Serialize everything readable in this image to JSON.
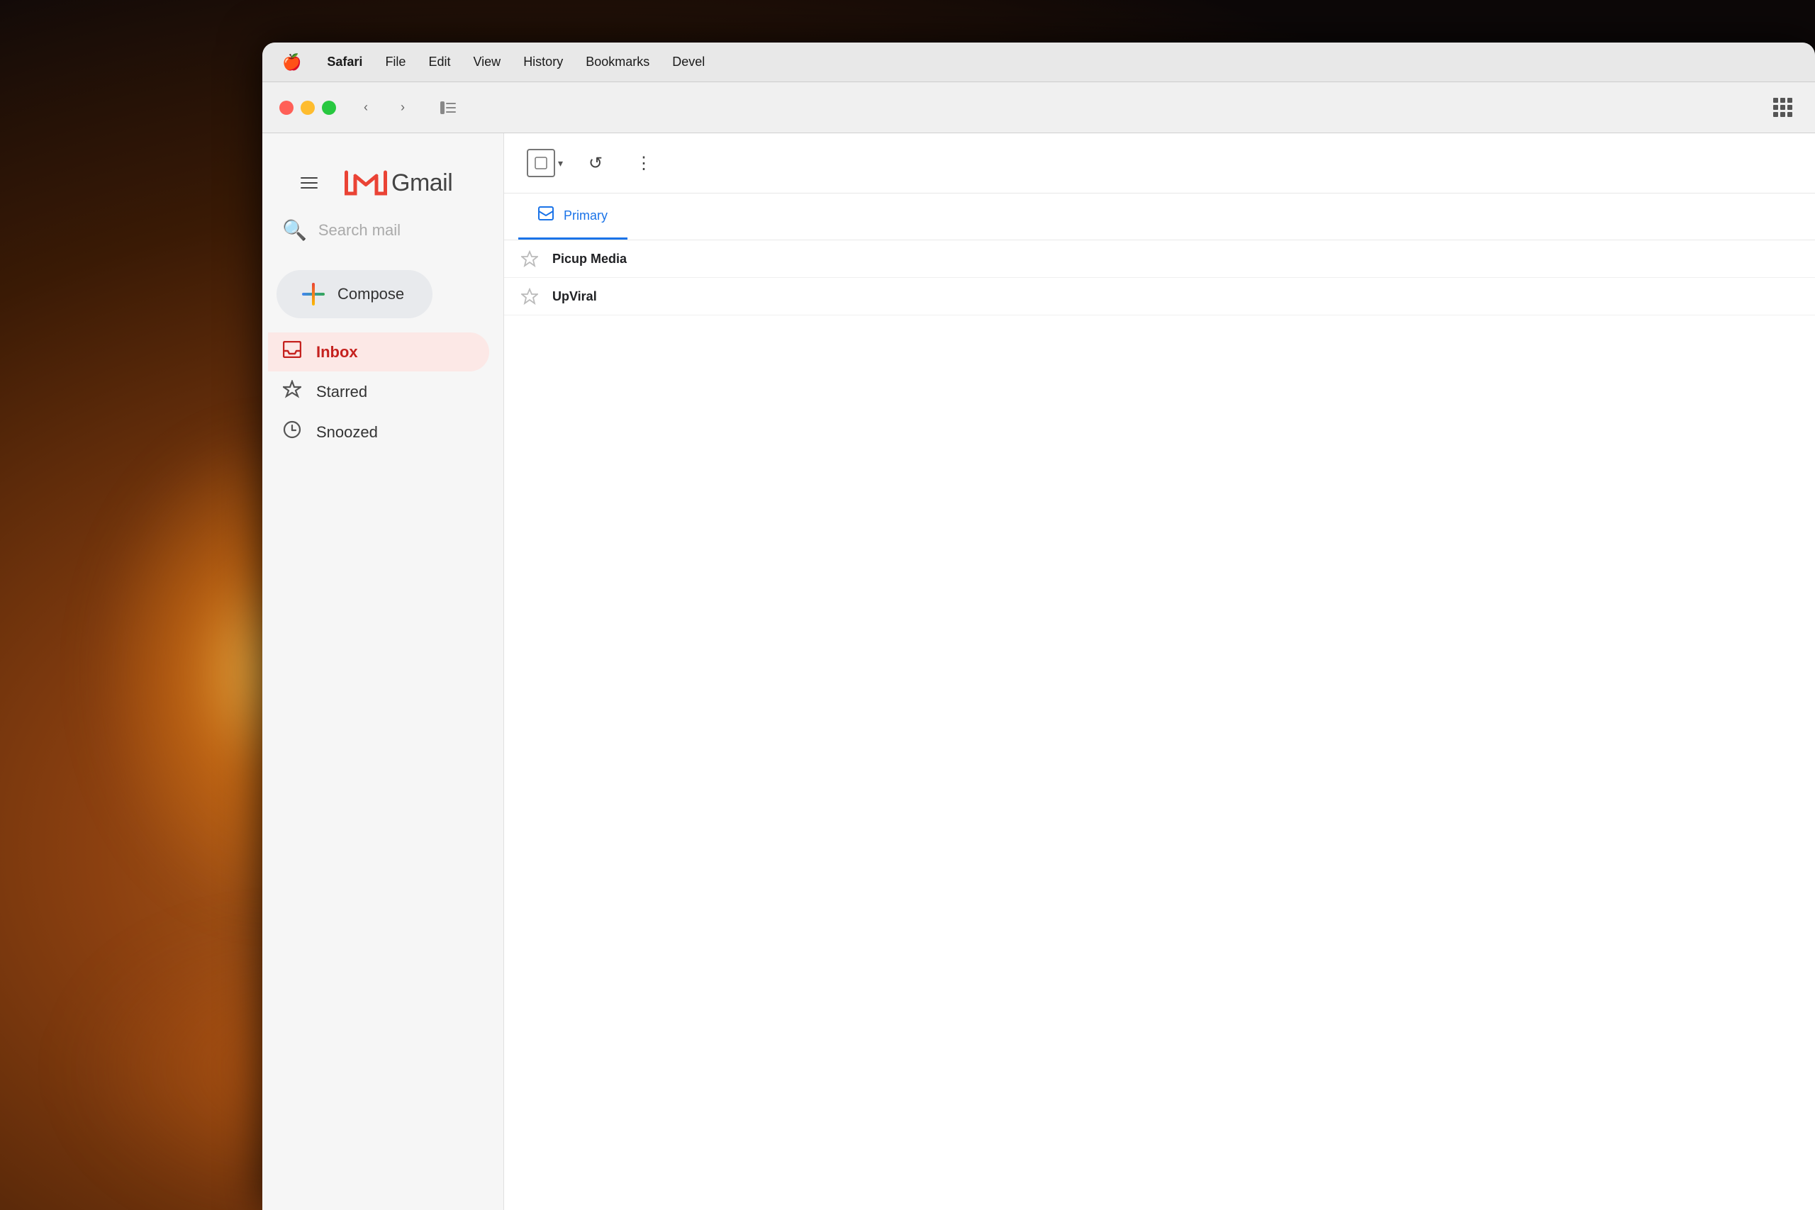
{
  "background": {
    "color": "#1a0d05"
  },
  "menubar": {
    "apple_icon": "🍎",
    "items": [
      {
        "label": "Safari",
        "bold": true
      },
      {
        "label": "File"
      },
      {
        "label": "Edit"
      },
      {
        "label": "View"
      },
      {
        "label": "History"
      },
      {
        "label": "Bookmarks"
      },
      {
        "label": "Devel"
      }
    ]
  },
  "safari_toolbar": {
    "back_label": "‹",
    "forward_label": "›",
    "sidebar_icon": "⊡"
  },
  "gmail": {
    "hamburger_label": "☰",
    "logo_text": "Gmail",
    "search_placeholder": "Search mail",
    "compose_label": "Compose",
    "nav_items": [
      {
        "id": "inbox",
        "label": "Inbox",
        "icon": "inbox",
        "active": true
      },
      {
        "id": "starred",
        "label": "Starred",
        "icon": "star",
        "active": false
      },
      {
        "id": "snoozed",
        "label": "Snoozed",
        "icon": "clock",
        "active": false
      }
    ],
    "tabs": [
      {
        "id": "primary",
        "label": "Primary",
        "active": true
      }
    ],
    "email_rows": [
      {
        "sender": "Picup Media",
        "starred": false
      },
      {
        "sender": "UpViral",
        "starred": false
      }
    ],
    "toolbar": {
      "refresh_icon": "↺",
      "more_icon": "⋮"
    }
  }
}
